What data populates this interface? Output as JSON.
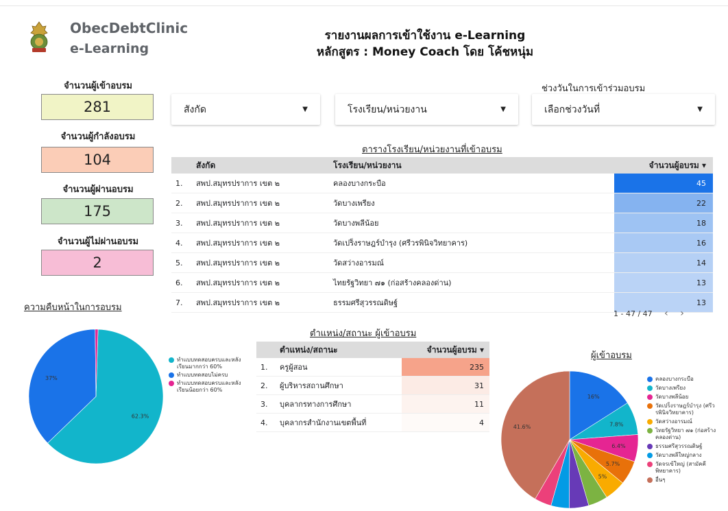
{
  "header": {
    "brand_line1": "ObecDebtClinic",
    "brand_line2": "e-Learning",
    "title_line1": "รายงานผลการเข้าใช้งาน e-Learning",
    "title_line2": "หลักสูตร : Money Coach โดย โค้ชหนุ่ม"
  },
  "kpis": [
    {
      "label": "จำนวนผู้เข้าอบรม",
      "value": "281",
      "color": "#f1f4c6"
    },
    {
      "label": "จำนวนผู้กำลังอบรม",
      "value": "104",
      "color": "#fbcdb7"
    },
    {
      "label": "จำนวนผู้ผ่านอบรม",
      "value": "175",
      "color": "#cde6c9"
    },
    {
      "label": "จำนวนผู้ไม่ผ่านอบรม",
      "value": "2",
      "color": "#f7bdd6"
    }
  ],
  "filters": {
    "affiliation": "สังกัด",
    "school": "โรงเรียน/หน่วยงาน",
    "date_caption": "ช่วงวันในการเข้าร่วมอบรม",
    "date": "เลือกช่วงวันที่"
  },
  "school_table": {
    "title": "ตารางโรงเรียน/หน่วยงานที่เข้าอบรม",
    "headers": [
      "สังกัด",
      "โรงเรียน/หน่วยงาน",
      "จำนวนผู้อบรม ▾"
    ],
    "rows": [
      {
        "n": "1.",
        "aff": "สพป.สมุทรปราการ เขต ๒",
        "school": "คลองบางกระบือ",
        "value": 45,
        "color": "#1a73e8"
      },
      {
        "n": "2.",
        "aff": "สพป.สมุทรปราการ เขต ๒",
        "school": "วัดบางเพรียง",
        "value": 22,
        "color": "#85b3f0"
      },
      {
        "n": "3.",
        "aff": "สพป.สมุทรปราการ เขต ๒",
        "school": "วัดบางพลีน้อย",
        "value": 18,
        "color": "#9ec3f3"
      },
      {
        "n": "4.",
        "aff": "สพป.สมุทรปราการ เขต ๒",
        "school": "วัดเปร็งราษฎร์บำรุง (ศรีวรพินิจวิทยาคาร)",
        "value": 16,
        "color": "#a9c9f4"
      },
      {
        "n": "5.",
        "aff": "สพป.สมุทรปราการ เขต ๒",
        "school": "วัดสว่างอารมณ์",
        "value": 14,
        "color": "#b5d0f5"
      },
      {
        "n": "6.",
        "aff": "สพป.สมุทรปราการ เขต ๒",
        "school": "ไทยรัฐวิทยา ๗๑ (ก่อสร้างคลองด่าน)",
        "value": 13,
        "color": "#bad3f6"
      },
      {
        "n": "7.",
        "aff": "สพป.สมุทรปราการ เขต ๒",
        "school": "ธรรมศรีสุวรรณดิษฐ์",
        "value": 13,
        "color": "#bad3f6"
      }
    ],
    "pager": "1 - 47 / 47"
  },
  "position_table": {
    "title": "ตำแหน่ง/สถานะ ผู้เข้าอบรม",
    "headers": [
      "ตำแหน่ง/สถานะ",
      "จำนวนผู้อบรม ▾"
    ],
    "rows": [
      {
        "n": "1.",
        "label": "ครูผู้สอน",
        "value": 235,
        "color": "#f6a38a"
      },
      {
        "n": "2.",
        "label": "ผู้บริหารสถานศึกษา",
        "value": 31,
        "color": "#fcebe5"
      },
      {
        "n": "3.",
        "label": "บุคลากรทางการศึกษา",
        "value": 11,
        "color": "#fdf3ef"
      },
      {
        "n": "4.",
        "label": "บุคลากรสำนักงานเขตพื้นที่",
        "value": 4,
        "color": "#fefaf8"
      }
    ]
  },
  "chart_data": [
    {
      "type": "pie",
      "title": "ความคืบหน้าในการอบรม",
      "categories": [
        "ทำแบบทดสอบครบและหลังเรียนมากกว่า 60%",
        "ทำแบบทดสอบไม่ครบ",
        "ทำแบบทดสอบครบและหลังเรียนน้อยกว่า 60%"
      ],
      "values": [
        62.3,
        37,
        0.7
      ],
      "labels": [
        "62.3%",
        "37%",
        ""
      ],
      "colors": [
        "#12b5cb",
        "#1a73e8",
        "#e52592"
      ],
      "legend": "right"
    },
    {
      "type": "pie",
      "title": "ผู้เข้าอบรม",
      "categories": [
        "คลองบางกระบือ",
        "วัดบางเพรียง",
        "วัดบางพลีน้อย",
        "วัดเปร็งราษฎร์บำรุง (ศรีวรพินิจวิทยาคาร)",
        "วัดสว่างอารมณ์",
        "ไทยรัฐวิทยา ๗๑ (ก่อสร้างคลองด่าน)",
        "ธรรมศรีสุวรรณดิษฐ์",
        "วัดบางพลีใหญ่กลาง",
        "วัดจรเข้ใหญ่ (สามัคคีพิทยาคาร)",
        "อื่นๆ"
      ],
      "values": [
        16,
        7.8,
        6.4,
        5.7,
        5,
        4.6,
        4.6,
        4.3,
        4,
        41.6
      ],
      "labels": [
        "16%",
        "7.8%",
        "6.4%",
        "5.7%",
        "5%",
        "",
        "",
        "",
        "",
        "41.6%"
      ],
      "colors": [
        "#1a73e8",
        "#12b5cb",
        "#e52592",
        "#e8710a",
        "#f9ab00",
        "#7cb342",
        "#673ab7",
        "#039be5",
        "#ec407a",
        "#c5705a"
      ],
      "legend": "right"
    }
  ]
}
